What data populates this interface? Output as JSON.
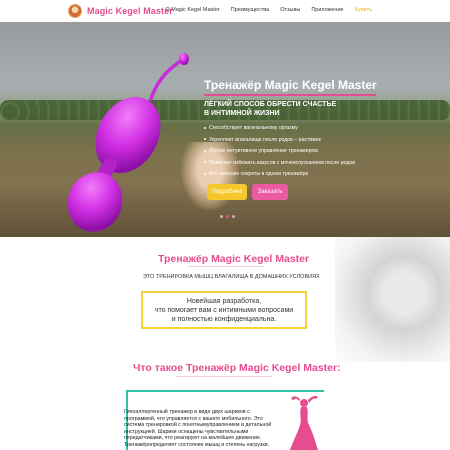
{
  "header": {
    "logo_text": "Magic Kegel Master",
    "nav": [
      {
        "label": "О Magic Kegel Master"
      },
      {
        "label": "Преимущества"
      },
      {
        "label": "Отзывы"
      },
      {
        "label": "Приложение"
      },
      {
        "label": "Купить"
      }
    ]
  },
  "hero": {
    "title": "Тренажёр Magic Kegel Master",
    "subtitle_line1": "ЛЁГКИЙ СПОСОБ ОБРЕСТИ СЧАСТЬЕ",
    "subtitle_line2": "В ИНТИМНОЙ ЖИЗНИ",
    "bullets": [
      "Способствует вагинальному оргазму",
      "Укрепляет влагалище после родов – растяжек",
      "Лёгкое интуитивное управление тренажером",
      "Помогает избежать казусов с мочеиспусканием после родов",
      "Все женские секреты в одном тренажёре"
    ],
    "btn_more": "Подробнее",
    "btn_order": "Заказать",
    "colors": {
      "accent": "#e64d8f",
      "yellow": "#f4c82a",
      "toy": "#d633e8"
    }
  },
  "section2": {
    "title": "Тренажёр Magic Kegel Master",
    "subtitle": "ЭТО ТРЕНИРОВКА МЫШЦ ВЛАГАЛИЩА В ДОМАШНИХ УСЛОВИЯХ",
    "quote_line1": "Новейшая разработка,",
    "quote_line2": "что помогает вам с интимными вопросами",
    "quote_line3": "и полностью конфиденциальна."
  },
  "section3": {
    "title": "Что такое Тренажёр Magic Kegel Master:",
    "text": "Гипоаллергенный тренажер в виде двух шариков с программой, что управляется с вашего мобильного. Это система тренировкой с понятнымуправлением и детальной инструкцией. Шарики оснащены чувствительными передатчиками, что реагируют на малейшее движение. Тренажёропределяет состояние мышц и степень нагрузки."
  }
}
